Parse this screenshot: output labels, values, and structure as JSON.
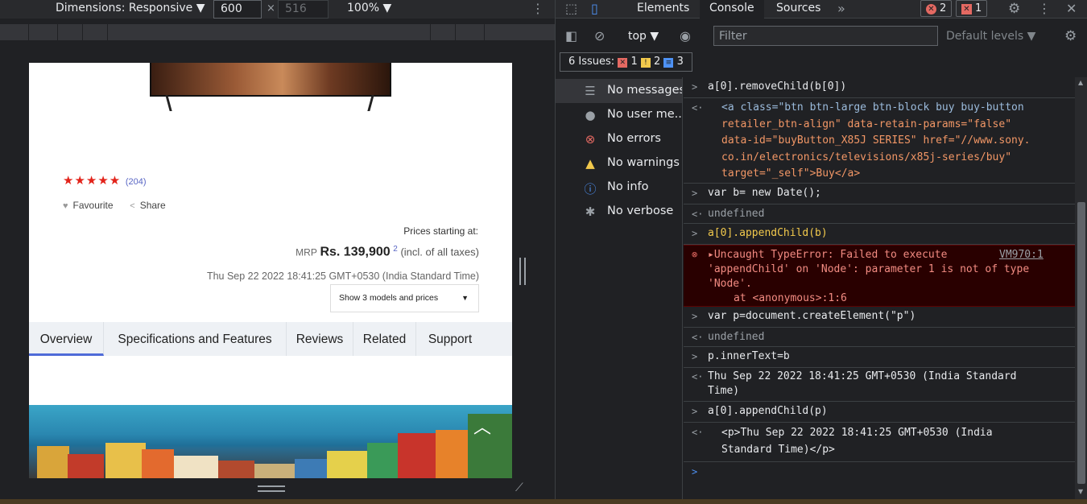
{
  "device_toolbar": {
    "dimensions_label": "Dimensions: Responsive ▼",
    "width": "600",
    "times": "×",
    "height": "516",
    "zoom": "100% ▼"
  },
  "page": {
    "rating_stars": "★★★★★",
    "rating_count": "(204)",
    "favourite": "Favourite",
    "share": "Share",
    "prices_label": "Prices starting at:",
    "mrp": "MRP",
    "price": "Rs. 139,900",
    "price_note": "2",
    "price_tax": "(incl. of all taxes)",
    "date": "Thu Sep 22 2022 18:41:25 GMT+0530 (India Standard Time)",
    "models_button": "Show 3 models and prices",
    "tabs": [
      "Overview",
      "Specifications and Features",
      "Reviews",
      "Related",
      "Support"
    ]
  },
  "devtools": {
    "tabs": [
      "Elements",
      "Console",
      "Sources"
    ],
    "error_badge": "2",
    "issue_badge": "1",
    "context": "top ▼",
    "filter_placeholder": "Filter",
    "levels": "Default levels ▼",
    "issues": {
      "label": "6 Issues:",
      "errors": "1",
      "warnings": "2",
      "info": "3"
    },
    "sidebar": [
      "No messages",
      "No user me...",
      "No errors",
      "No warnings",
      "No info",
      "No verbose"
    ],
    "console": {
      "e1": "a[0].removeChild(b[0])",
      "e2_line1_a": "<a class=\"btn btn-large btn-block buy buy-button",
      "e2_line2": "retailer_btn-align\" data-retain-params=\"false\"",
      "e2_line3": "data-id=\"buyButton_X85J SERIES\" href=\"//www.sony.",
      "e2_line4": "co.in/electronics/televisions/x85j-series/buy\"",
      "e2_line5": "target=\"_self\">Buy</a>",
      "e3": "var b= new Date();",
      "e4": "undefined",
      "e5": "a[0].appendChild(b)",
      "err_line1": "Uncaught TypeError: Failed to execute",
      "err_link": "VM970:1",
      "err_line2": "'appendChild' on 'Node': parameter 1 is not of type",
      "err_line3": "'Node'.",
      "err_line4": "at <anonymous>:1:6",
      "e7": "var p=document.createElement(\"p\")",
      "e8": "undefined",
      "e9": "p.innerText=b",
      "e10_line1": "Thu Sep 22 2022 18:41:25 GMT+0530 (India Standard",
      "e10_line2": "Time)",
      "e11": "a[0].appendChild(p)",
      "e12_line1": "<p>Thu Sep 22 2022 18:41:25 GMT+0530 (India",
      "e12_line2": "Standard Time)</p>",
      "prompt": ">"
    }
  },
  "colors": {
    "accent": "#4f6bd8",
    "error": "#e46962",
    "devtools_bg": "#202124"
  }
}
